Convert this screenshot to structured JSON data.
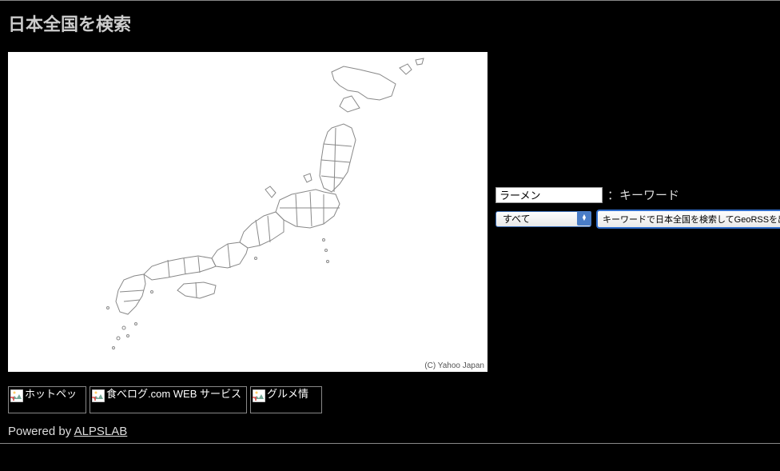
{
  "header": {
    "title": "日本全国を検索"
  },
  "map": {
    "credit": "(C) Yahoo Japan"
  },
  "search": {
    "keyword_value": "ラーメン",
    "keyword_label": "：キーワード",
    "category_selected": "すべて",
    "submit_label": "キーワードで日本全国を検索してGeoRSSを出力"
  },
  "footer_images": {
    "img1_alt": "ホットペッ",
    "img2_alt": "食べログ.com WEB サービス",
    "img3_alt": "グルメ情"
  },
  "powered": {
    "prefix": "Powered by ",
    "link_text": "ALPSLAB"
  }
}
